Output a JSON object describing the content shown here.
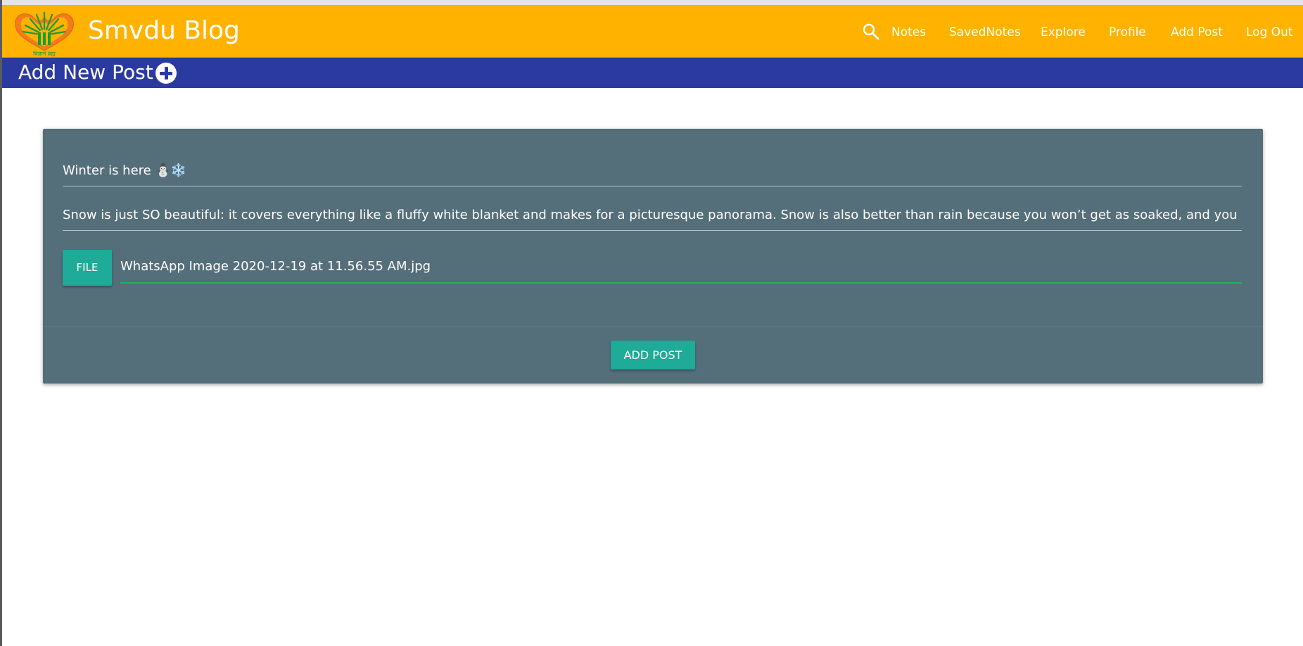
{
  "navbar": {
    "brand": "Smvdu Blog",
    "logo_icon": "smvdu-logo-icon",
    "logo_caption": "विज्ञानं ब्रह्म",
    "search_icon": "search-icon",
    "links": [
      "Notes",
      "SavedNotes",
      "Explore",
      "Profile",
      "Add Post",
      "Log Out"
    ]
  },
  "header": {
    "title": "Add New Post",
    "add_icon": "plus-circle-icon"
  },
  "form": {
    "title_value": "Winter is here ⛄❄️",
    "body_value": "Snow is just SO beautiful: it covers everything like a fluffy white blanket and makes for a picturesque panorama. Snow is also better than rain because you won’t get as soaked, and you can actually do",
    "file_button_label": "FILE",
    "file_path_value": "WhatsApp Image 2020-12-19 at 11.56.55 AM.jpg",
    "submit_label": "ADD POST"
  },
  "colors": {
    "navbar": "#ffb200",
    "title_band": "#2b3aa1",
    "card": "#546e7a",
    "button": "#1eab97",
    "file_underline": "#1fb25a"
  }
}
